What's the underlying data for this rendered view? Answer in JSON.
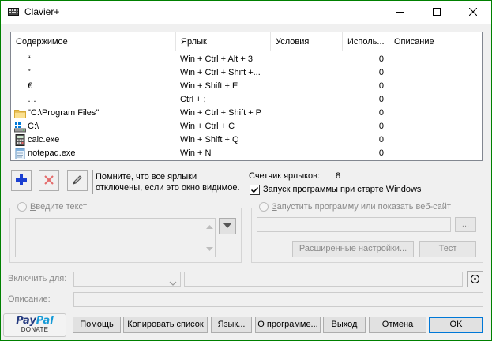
{
  "window": {
    "title": "Clavier+",
    "icon": "keyboard-icon",
    "controls": [
      "minimize-icon",
      "maximize-icon",
      "close-icon"
    ]
  },
  "listview": {
    "columns": [
      "Содержимое",
      "Ярлык",
      "Условия",
      "Исполь...",
      "Описание"
    ],
    "rows": [
      {
        "icon": "",
        "content": "“",
        "shortcut": "Win + Ctrl + Alt + 3",
        "conditions": "",
        "usage": "0",
        "description": ""
      },
      {
        "icon": "",
        "content": "”",
        "shortcut": "Win + Ctrl + Shift +...",
        "conditions": "",
        "usage": "0",
        "description": ""
      },
      {
        "icon": "",
        "content": "€",
        "shortcut": "Win + Shift + E",
        "conditions": "",
        "usage": "0",
        "description": ""
      },
      {
        "icon": "",
        "content": "…",
        "shortcut": "Ctrl + ;",
        "conditions": "",
        "usage": "0",
        "description": ""
      },
      {
        "icon": "folder-icon",
        "content": "\"C:\\Program Files\"",
        "shortcut": "Win + Ctrl + Shift + P",
        "conditions": "",
        "usage": "0",
        "description": ""
      },
      {
        "icon": "drive-icon",
        "content": "C:\\",
        "shortcut": "Win + Ctrl + C",
        "conditions": "",
        "usage": "0",
        "description": ""
      },
      {
        "icon": "calculator-icon",
        "content": "calc.exe",
        "shortcut": "Win + Shift + Q",
        "conditions": "",
        "usage": "0",
        "description": ""
      },
      {
        "icon": "notepad-icon",
        "content": "notepad.exe",
        "shortcut": "Win + N",
        "conditions": "",
        "usage": "0",
        "description": ""
      }
    ]
  },
  "toolbar": {
    "add_icon": "plus-icon",
    "delete_icon": "delete-icon",
    "edit_icon": "pencil-icon",
    "hint": "Помните, что все ярлыки отключены, если это окно видимое."
  },
  "counter": {
    "label": "Счетчик ярлыков:",
    "value": "8"
  },
  "startup": {
    "label": "Запуск программы при старте Windows",
    "checked": true
  },
  "text_group": {
    "label": "Введите текст",
    "accel": "В",
    "rest": "ведите текст"
  },
  "launch_group": {
    "label": "Запустить программу или показать веб-сайт",
    "accel": "З",
    "rest": "апустить программу или показать веб-сайт",
    "browse_label": "...",
    "advanced_label": "Расширенные настройки...",
    "test_label": "Тест"
  },
  "enable_for": {
    "label": "Включить для:"
  },
  "description": {
    "label": "Описание:"
  },
  "buttons": {
    "help": "Помощь",
    "copy_list": "Копировать список",
    "language": "Язык...",
    "about": "О программе...",
    "exit": "Выход",
    "cancel": "Отмена",
    "ok": "OK"
  },
  "paypal": {
    "word1": "Pay",
    "word2": "Pal",
    "donate": "DONATE"
  },
  "colors": {
    "border": "#008000",
    "accent": "#0078d7"
  }
}
